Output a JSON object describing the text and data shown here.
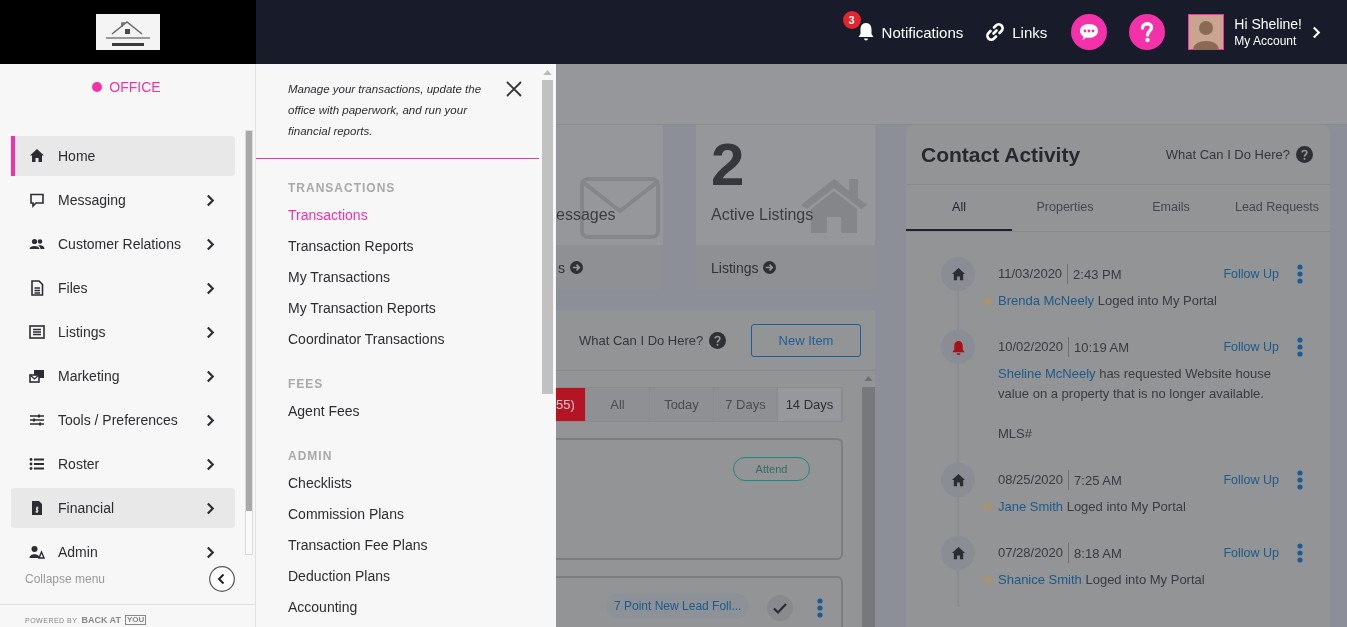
{
  "header": {
    "notifications": {
      "label": "Notifications",
      "badge": "3"
    },
    "links": {
      "label": "Links"
    },
    "account": {
      "greeting": "Hi Sheline!",
      "link": "My Account"
    }
  },
  "sidebar": {
    "office": "OFFICE",
    "items": [
      {
        "label": "Home",
        "kind": "home",
        "selected": true,
        "expanded": false,
        "has_submenu": false
      },
      {
        "label": "Messaging",
        "kind": "chat",
        "selected": false,
        "expanded": false,
        "has_submenu": true
      },
      {
        "label": "Customer Relations",
        "kind": "people",
        "selected": false,
        "expanded": false,
        "has_submenu": true
      },
      {
        "label": "Files",
        "kind": "file",
        "selected": false,
        "expanded": false,
        "has_submenu": true
      },
      {
        "label": "Listings",
        "kind": "list",
        "selected": false,
        "expanded": false,
        "has_submenu": true
      },
      {
        "label": "Marketing",
        "kind": "marketing",
        "selected": false,
        "expanded": false,
        "has_submenu": true
      },
      {
        "label": "Tools / Preferences",
        "kind": "sliders",
        "selected": false,
        "expanded": false,
        "has_submenu": true
      },
      {
        "label": "Roster",
        "kind": "roster",
        "selected": false,
        "expanded": false,
        "has_submenu": true
      },
      {
        "label": "Financial",
        "kind": "financial",
        "selected": false,
        "expanded": true,
        "has_submenu": true
      },
      {
        "label": "Admin",
        "kind": "admin",
        "selected": false,
        "expanded": false,
        "has_submenu": true
      }
    ],
    "collapse": "Collapse menu",
    "footer": {
      "prefix": "POWERED BY",
      "brand": "BACK AT",
      "brand_box": "YOU"
    }
  },
  "flyout": {
    "description": "Manage your transactions, update the office with paperwork, and run your financial reports.",
    "sections": [
      {
        "heading": "TRANSACTIONS",
        "links": [
          {
            "label": "Transactions",
            "selected": true
          },
          {
            "label": "Transaction Reports",
            "selected": false
          },
          {
            "label": "My Transactions",
            "selected": false
          },
          {
            "label": "My Transaction Reports",
            "selected": false
          },
          {
            "label": "Coordinator Transactions",
            "selected": false
          }
        ]
      },
      {
        "heading": "FEES",
        "links": [
          {
            "label": "Agent Fees",
            "selected": false
          }
        ]
      },
      {
        "heading": "ADMIN",
        "links": [
          {
            "label": "Checklists",
            "selected": false
          },
          {
            "label": "Commission Plans",
            "selected": false
          },
          {
            "label": "Transaction Fee Plans",
            "selected": false
          },
          {
            "label": "Deduction Plans",
            "selected": false
          },
          {
            "label": "Accounting",
            "selected": false
          }
        ]
      }
    ]
  },
  "dashboard": {
    "stat_cards": [
      {
        "kind": "messages",
        "label": "essages",
        "link": "s"
      },
      {
        "kind": "listings",
        "count": "2",
        "label": "Active Listings",
        "link": "Listings"
      }
    ],
    "tasks": {
      "help": "What Can I Do Here?",
      "new_button": "New Item",
      "filters": [
        {
          "label": "55)",
          "kind": "alert",
          "selected": false
        },
        {
          "label": "All",
          "kind": "range",
          "selected": false
        },
        {
          "label": "Today",
          "kind": "range",
          "selected": false
        },
        {
          "label": "7 Days",
          "kind": "range",
          "selected": false
        },
        {
          "label": "14 Days",
          "kind": "range",
          "selected": true
        }
      ],
      "items": [
        {
          "kind": "event",
          "action": "Attend"
        },
        {
          "kind": "task",
          "tag": "7 Point New Lead Foll...",
          "done": true
        }
      ]
    }
  },
  "contact_activity": {
    "title": "Contact Activity",
    "help": "What Can I Do Here?",
    "tabs": [
      {
        "label": "All",
        "selected": true
      },
      {
        "label": "Properties",
        "selected": false
      },
      {
        "label": "Emails",
        "selected": false
      },
      {
        "label": "Lead Requests",
        "selected": false
      }
    ],
    "entries": [
      {
        "kind": "home",
        "date": "11/03/2020",
        "time": "2:43 PM",
        "action": "Follow Up",
        "starred": true,
        "contact": "Brenda McNeely",
        "message": "Loged into My Portal"
      },
      {
        "kind": "bell",
        "date": "10/02/2020",
        "time": "10:19 AM",
        "action": "Follow Up",
        "starred": false,
        "contact": "Sheline McNeely",
        "message": "has requested Website house value on a property that is no longer available.",
        "note": "MLS#"
      },
      {
        "kind": "home",
        "date": "08/25/2020",
        "time": "7:25 AM",
        "action": "Follow Up",
        "starred": true,
        "contact": "Jane Smith",
        "message": "Loged into My Portal"
      },
      {
        "kind": "home",
        "date": "07/28/2020",
        "time": "8:18 AM",
        "action": "Follow Up",
        "starred": true,
        "contact": "Shanice Smith",
        "message": "Loged into My Portal"
      }
    ]
  }
}
